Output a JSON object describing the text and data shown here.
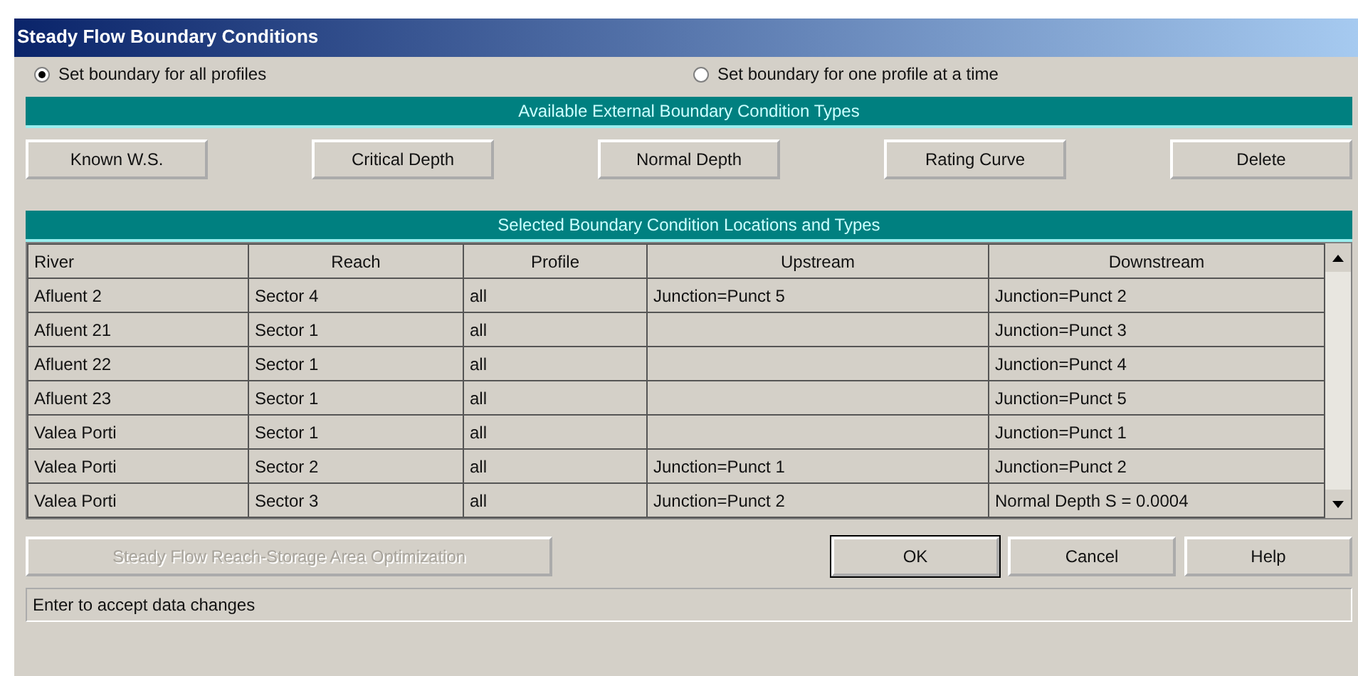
{
  "window": {
    "title": "Steady Flow Boundary Conditions"
  },
  "mode_options": [
    {
      "label": "Set boundary for all profiles",
      "selected": true
    },
    {
      "label": "Set boundary for one profile at a time",
      "selected": false
    }
  ],
  "types_header": "Available External Boundary Condition Types",
  "type_buttons": [
    "Known W.S.",
    "Critical Depth",
    "Normal Depth",
    "Rating Curve",
    "Delete"
  ],
  "table": {
    "title": "Selected Boundary Condition Locations and Types",
    "columns": [
      "River",
      "Reach",
      "Profile",
      "Upstream",
      "Downstream"
    ],
    "rows": [
      [
        "Afluent 2",
        "Sector 4",
        "all",
        "Junction=Punct 5",
        "Junction=Punct 2"
      ],
      [
        "Afluent 21",
        "Sector 1",
        "all",
        "",
        "Junction=Punct 3"
      ],
      [
        "Afluent 22",
        "Sector 1",
        "all",
        "",
        "Junction=Punct 4"
      ],
      [
        "Afluent 23",
        "Sector 1",
        "all",
        "",
        "Junction=Punct 5"
      ],
      [
        "Valea Porti",
        "Sector 1",
        "all",
        "",
        "Junction=Punct 1"
      ],
      [
        "Valea Porti",
        "Sector 2",
        "all",
        "Junction=Punct 1",
        "Junction=Punct 2"
      ],
      [
        "Valea Porti",
        "Sector 3",
        "all",
        "Junction=Punct 2",
        "Normal Depth S = 0.0004"
      ]
    ]
  },
  "optimization_button": {
    "label": "Steady Flow Reach-Storage Area Optimization",
    "disabled": true
  },
  "dialog_buttons": [
    {
      "label": "OK",
      "default": true
    },
    {
      "label": "Cancel",
      "default": false
    },
    {
      "label": "Help",
      "default": false
    }
  ],
  "status_bar": "Enter to accept data changes"
}
